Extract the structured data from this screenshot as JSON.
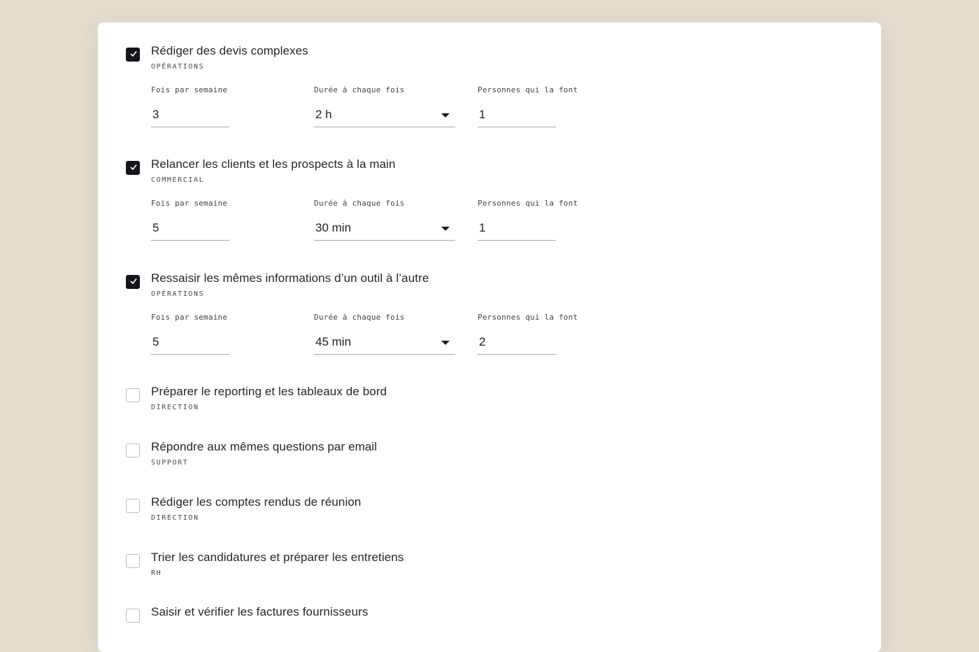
{
  "fields": {
    "frequency_label": "Fois par semaine",
    "duration_label": "Durée à chaque fois",
    "people_label": "Personnes qui la font"
  },
  "tasks": [
    {
      "title": "Rédiger des devis complexes",
      "category": "OPÉRATIONS",
      "checked": true,
      "frequency": "3",
      "duration": "2 h",
      "people": "1"
    },
    {
      "title": "Relancer les clients et les prospects à la main",
      "category": "COMMERCIAL",
      "checked": true,
      "frequency": "5",
      "duration": "30 min",
      "people": "1"
    },
    {
      "title": "Ressaisir les mêmes informations d’un outil à l’autre",
      "category": "OPÉRATIONS",
      "checked": true,
      "frequency": "5",
      "duration": "45 min",
      "people": "2"
    },
    {
      "title": "Préparer le reporting et les tableaux de bord",
      "category": "DIRECTION",
      "checked": false
    },
    {
      "title": "Répondre aux mêmes questions par email",
      "category": "SUPPORT",
      "checked": false
    },
    {
      "title": "Rédiger les comptes rendus de réunion",
      "category": "DIRECTION",
      "checked": false
    },
    {
      "title": "Trier les candidatures et préparer les entretiens",
      "category": "RH",
      "checked": false
    },
    {
      "title": "Saisir et vérifier les factures fournisseurs",
      "category": "",
      "checked": false
    }
  ]
}
